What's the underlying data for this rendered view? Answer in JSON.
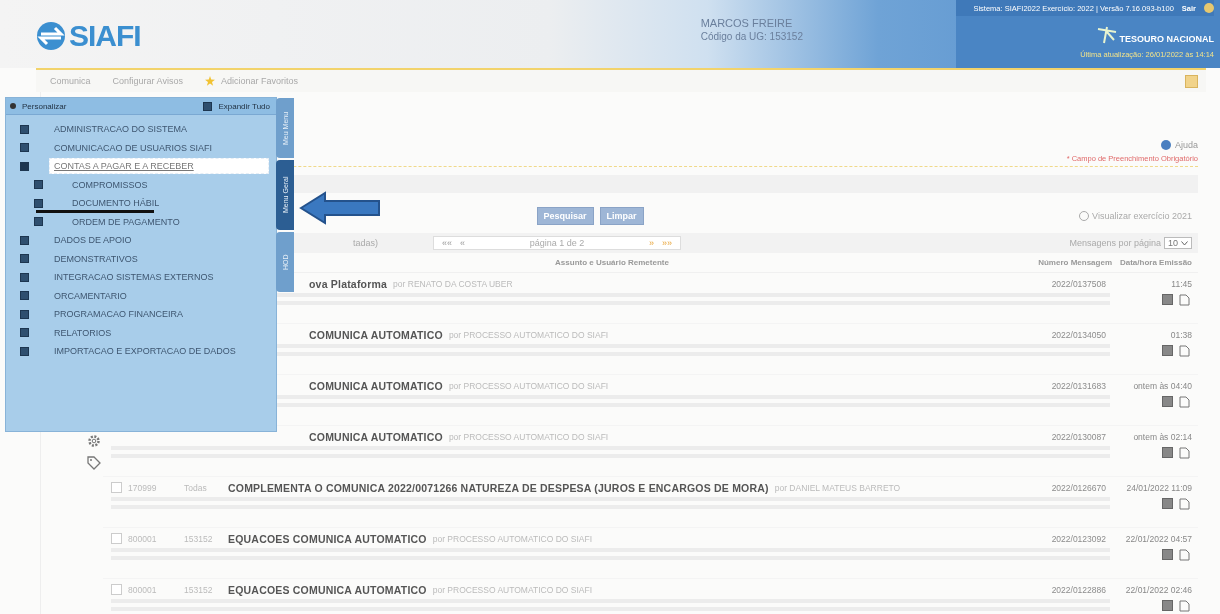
{
  "header": {
    "logo": "SIAFI",
    "user_name": "MARCOS FREIRE",
    "ug_code": "Código da UG: 153152",
    "system_info": "Sistema: SIAFI2022 Exercício: 2022 | Versão 7.16.093-b100",
    "logout": "Sair",
    "brand": "TESOURO NACIONAL",
    "last_update": "Última atualização: 26/01/2022 às 14:14"
  },
  "nav": [
    {
      "label": "Comunica",
      "kind": "link"
    },
    {
      "label": "Configurar Avisos",
      "kind": "link"
    },
    {
      "label": "Adicionar Favoritos",
      "kind": "favorite"
    }
  ],
  "content": {
    "help": "Ajuda",
    "required_note": "* Campo de Preenchimento Obrigatório",
    "buttons": [
      "Pesquisar",
      "Limpar"
    ],
    "previous_year": {
      "label": "Visualizar exercício 2021",
      "checked": false
    },
    "results_label": "tadas)",
    "pager": {
      "first": "««",
      "prev": "«",
      "text": "página 1 de 2",
      "next": "»",
      "last": "»»"
    },
    "per_page_label": "Mensagens por página",
    "per_page": "10",
    "columns": [
      "Assunto e Usuário Remetente",
      "Número Mensagem",
      "Data/hora Emissão"
    ],
    "rows": [
      {
        "title": "ova Plataforma",
        "sender": "por RENATO DA COSTA UBER",
        "number": "2022/0137508",
        "date": "11:45"
      },
      {
        "title": "COMUNICA AUTOMATICO",
        "sender": "por PROCESSO AUTOMATICO DO SIAFI",
        "number": "2022/0134050",
        "date": "01:38"
      },
      {
        "title": "COMUNICA AUTOMATICO",
        "sender": "por PROCESSO AUTOMATICO DO SIAFI",
        "number": "2022/0131683",
        "date": "ontem às 04:40"
      },
      {
        "title": "COMUNICA AUTOMATICO",
        "sender": "por PROCESSO AUTOMATICO DO SIAFI",
        "number": "2022/0130087",
        "date": "ontem às 02:14"
      },
      {
        "code": "170999",
        "ug": "Todas",
        "title": "COMPLEMENTA O COMUNICA 2022/0071266 NATUREZA DE DESPESA (JUROS E ENCARGOS DE MORA)",
        "sender": "por DANIEL MATEUS BARRETO",
        "number": "2022/0126670",
        "date": "24/01/2022 11:09",
        "checked": false
      },
      {
        "code": "800001",
        "ug": "153152",
        "title": "EQUACOES COMUNICA AUTOMATICO",
        "sender": "por PROCESSO AUTOMATICO DO SIAFI",
        "number": "2022/0123092",
        "date": "22/01/2022 04:57",
        "checked": false
      },
      {
        "code": "800001",
        "ug": "153152",
        "title": "EQUACOES COMUNICA AUTOMATICO",
        "sender": "por PROCESSO AUTOMATICO DO SIAFI",
        "number": "2022/0122886",
        "date": "22/01/2022 02:46",
        "checked": false
      }
    ]
  },
  "menu": {
    "customize": "Personalizar",
    "expand_all": "Expandir Tudo",
    "tabs": [
      {
        "label": "Meu Menu",
        "selected": false
      },
      {
        "label": "Menu Geral",
        "selected": true
      },
      {
        "label": "HOD",
        "selected": false
      }
    ],
    "items": [
      {
        "label": "ADMINISTRACAO DO SISTEMA",
        "expanded": false,
        "selected": false
      },
      {
        "label": "COMUNICACAO DE USUARIOS SIAFI",
        "expanded": false,
        "selected": false
      },
      {
        "label": "CONTAS A PAGAR E A RECEBER",
        "expanded": true,
        "selected": true,
        "children": [
          {
            "label": "COMPROMISSOS",
            "expanded": false,
            "selected": false
          },
          {
            "label": "DOCUMENTO HÁBIL",
            "expanded": false,
            "selected": false
          },
          {
            "label": "ORDEM DE PAGAMENTO",
            "expanded": false,
            "selected": false
          }
        ]
      },
      {
        "label": "DADOS DE APOIO",
        "expanded": false,
        "selected": false
      },
      {
        "label": "DEMONSTRATIVOS",
        "expanded": false,
        "selected": false
      },
      {
        "label": "INTEGRACAO SISTEMAS EXTERNOS",
        "expanded": false,
        "selected": false
      },
      {
        "label": "ORCAMENTARIO",
        "expanded": false,
        "selected": false
      },
      {
        "label": "PROGRAMACAO FINANCEIRA",
        "expanded": false,
        "selected": false
      },
      {
        "label": "RELATORIOS",
        "expanded": false,
        "selected": false
      },
      {
        "label": "IMPORTACAO E EXPORTACAO DE DADOS",
        "expanded": false,
        "selected": false
      }
    ]
  }
}
